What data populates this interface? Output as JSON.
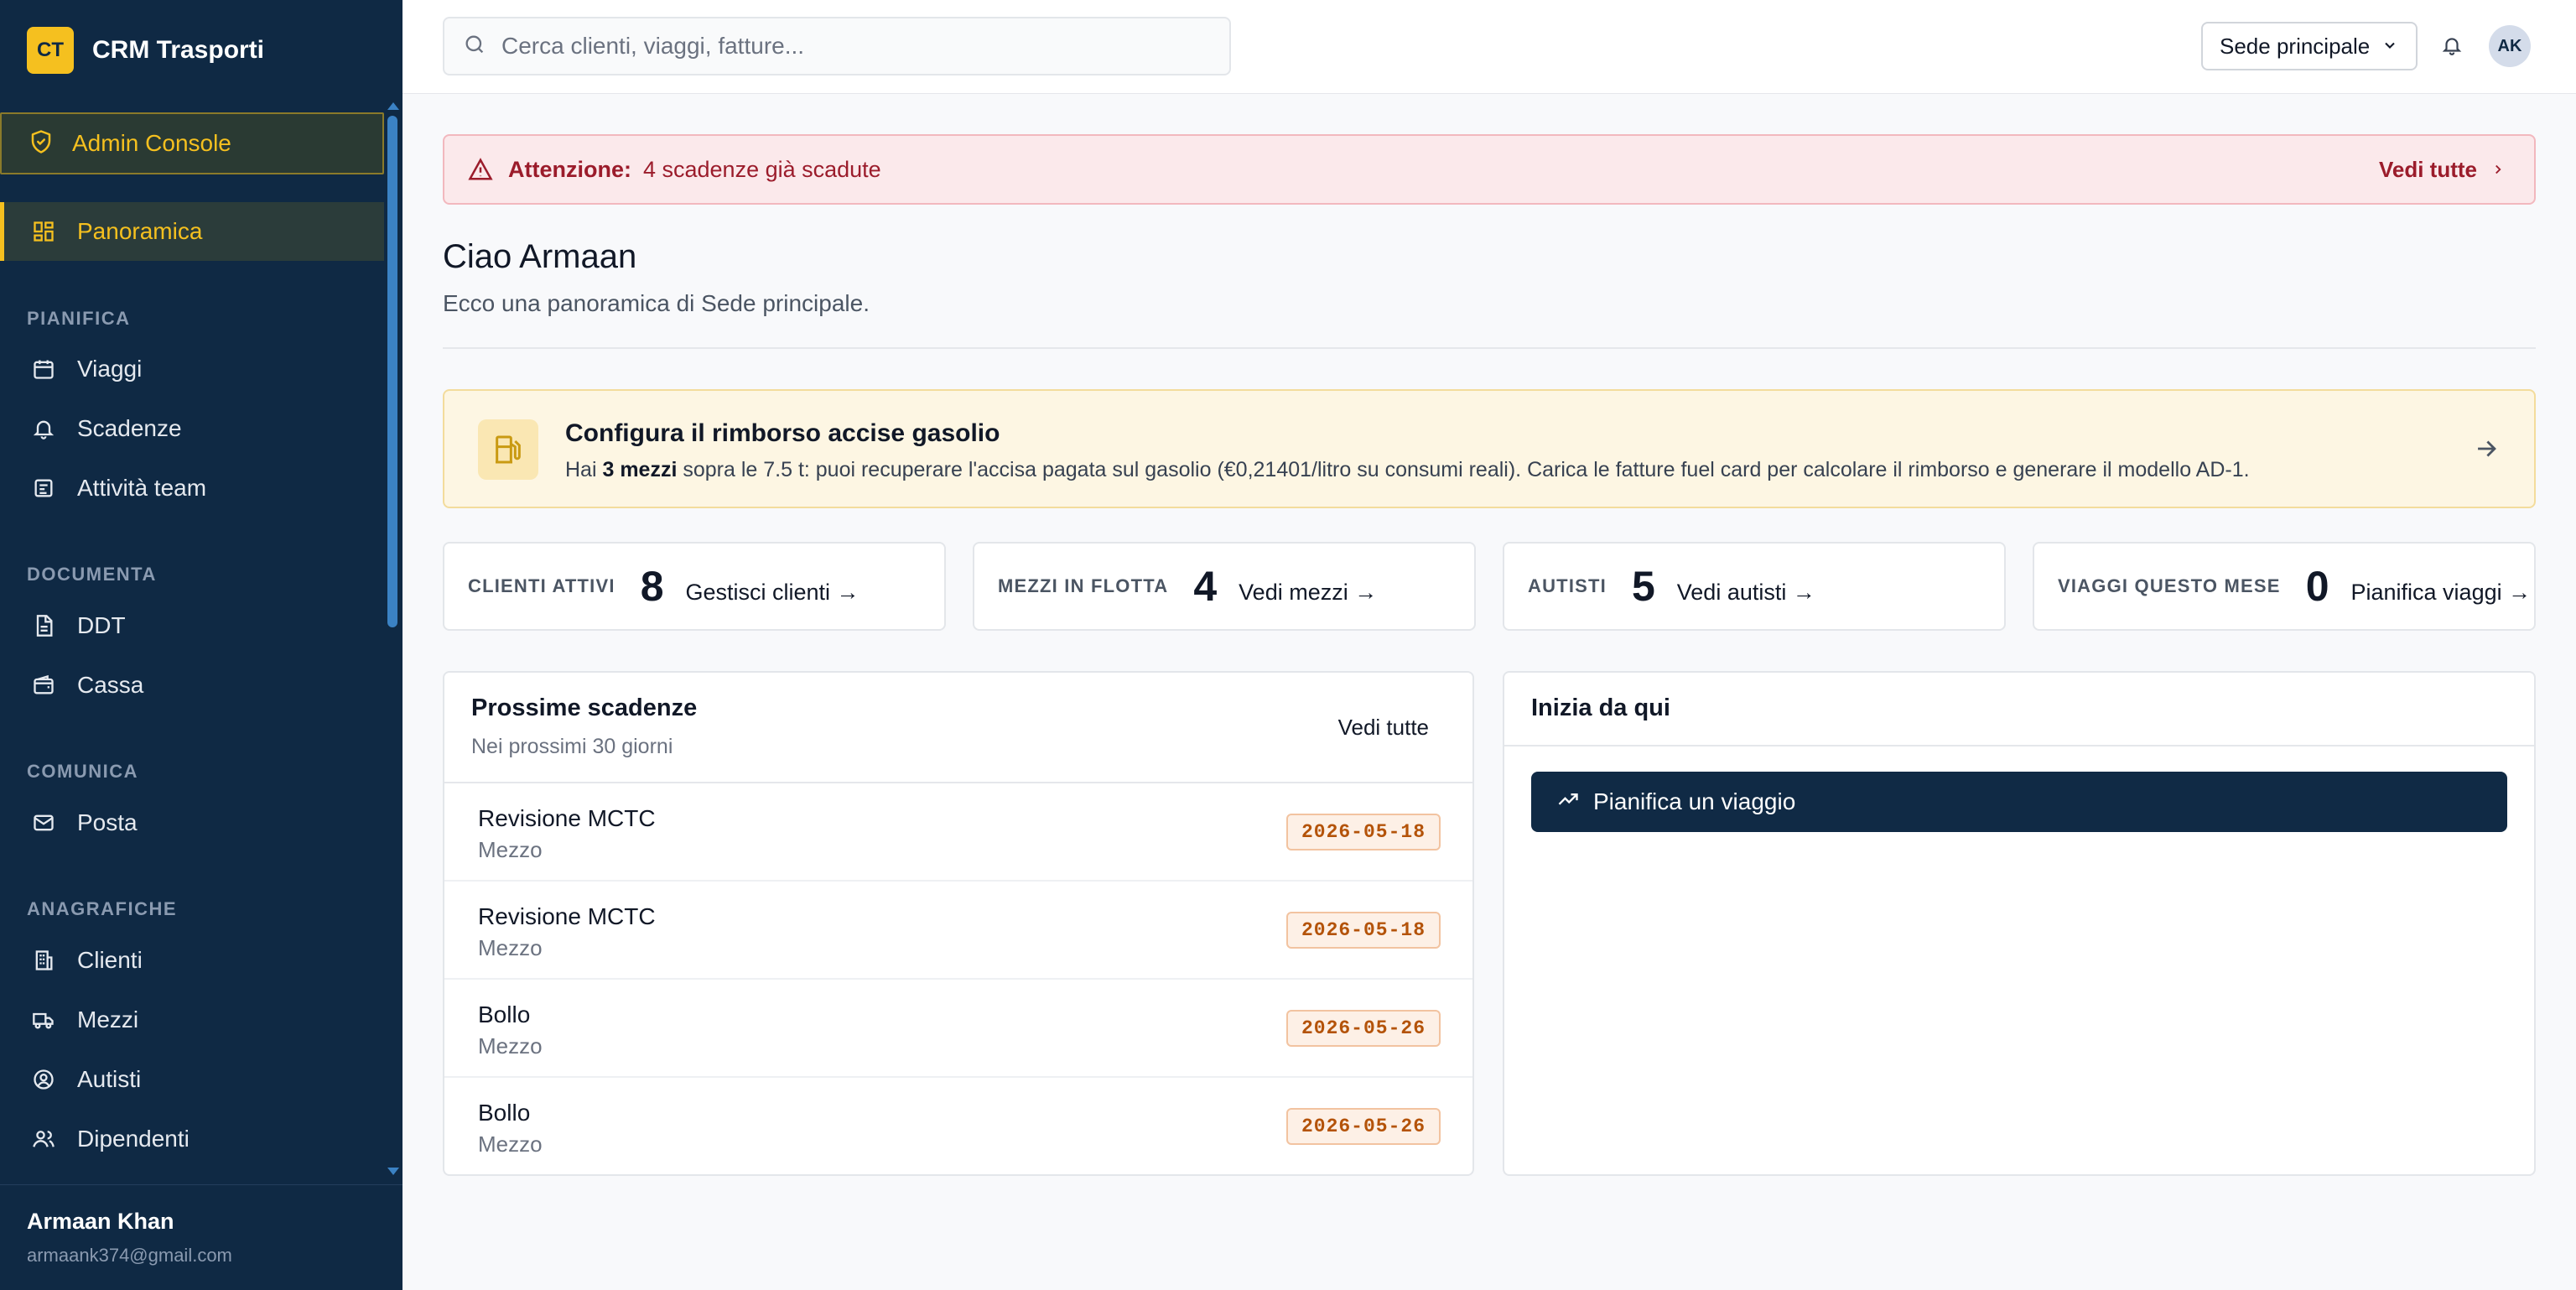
{
  "brand": {
    "badge": "CT",
    "name": "CRM Trasporti"
  },
  "sidebar": {
    "admin_console": "Admin Console",
    "active_item": "Panoramica",
    "sections": [
      {
        "title": "PIANIFICA",
        "items": [
          "Viaggi",
          "Scadenze",
          "Attività team"
        ]
      },
      {
        "title": "DOCUMENTA",
        "items": [
          "DDT",
          "Cassa"
        ]
      },
      {
        "title": "COMUNICA",
        "items": [
          "Posta"
        ]
      },
      {
        "title": "ANAGRAFICHE",
        "items": [
          "Clienti",
          "Mezzi",
          "Autisti",
          "Dipendenti"
        ]
      }
    ],
    "user": {
      "name": "Armaan Khan",
      "email": "armaank374@gmail.com"
    }
  },
  "topbar": {
    "search_placeholder": "Cerca clienti, viaggi, fatture...",
    "site": "Sede principale",
    "avatar": "AK"
  },
  "alert": {
    "title": "Attenzione:",
    "message": "4 scadenze già scadute",
    "link": "Vedi tutte"
  },
  "greeting": {
    "title": "Ciao Armaan",
    "subtitle": "Ecco una panoramica di Sede principale."
  },
  "promo": {
    "title": "Configura il rimborso accise gasolio",
    "text_prefix": "Hai ",
    "text_bold": "3 mezzi",
    "text_suffix": " sopra le 7.5 t: puoi recuperare l'accisa pagata sul gasolio (€0,21401/litro su consumi reali). Carica le fatture fuel card per calcolare il rimborso e generare il modello AD-1."
  },
  "stats": [
    {
      "label": "CLIENTI ATTIVI",
      "value": "8",
      "link": "Gestisci clienti →"
    },
    {
      "label": "MEZZI IN FLOTTA",
      "value": "4",
      "link": "Vedi mezzi →"
    },
    {
      "label": "AUTISTI",
      "value": "5",
      "link": "Vedi autisti →"
    },
    {
      "label": "VIAGGI QUESTO MESE",
      "value": "0",
      "link": "Pianifica viaggi →"
    }
  ],
  "deadlines": {
    "title": "Prossime scadenze",
    "subtitle": "Nei prossimi 30 giorni",
    "link": "Vedi tutte",
    "rows": [
      {
        "title": "Revisione MCTC",
        "sub": "Mezzo",
        "date": "2026-05-18"
      },
      {
        "title": "Revisione MCTC",
        "sub": "Mezzo",
        "date": "2026-05-18"
      },
      {
        "title": "Bollo",
        "sub": "Mezzo",
        "date": "2026-05-26"
      },
      {
        "title": "Bollo",
        "sub": "Mezzo",
        "date": "2026-05-26"
      }
    ]
  },
  "start": {
    "title": "Inizia da qui",
    "cta": "Pianifica un viaggio"
  },
  "colors": {
    "sidebar": "#0f2944",
    "accent": "#f5c01f",
    "alert_text": "#9b1c2b",
    "badge_text": "#b45309",
    "cta": "#102a45"
  }
}
